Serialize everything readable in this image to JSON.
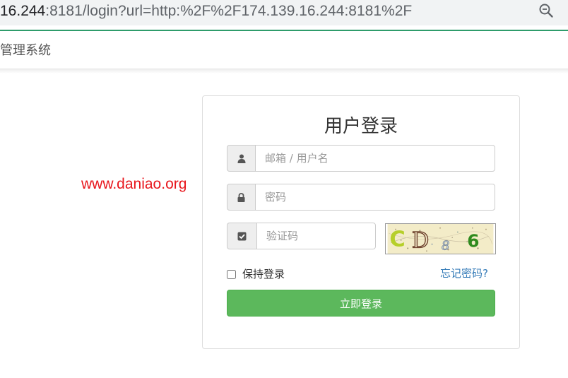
{
  "browser": {
    "url_host": "16.244",
    "url_rest": ":8181/login?url=http:%2F%2F174.139.16.244:8181%2F"
  },
  "navbar": {
    "brand": "管理系统"
  },
  "watermark": "www.daniao.org",
  "login": {
    "title": "用户登录",
    "username_placeholder": "邮箱 / 用户名",
    "password_placeholder": "密码",
    "captcha_placeholder": "验证码",
    "captcha_text": "CD86",
    "remember_label": "保持登录",
    "forgot_link": "忘记密码?",
    "submit_label": "立即登录"
  },
  "colors": {
    "primary_button": "#5cb85c",
    "link": "#337ab7",
    "watermark": "#e8161c",
    "accent_line": "#2e9c6b"
  }
}
